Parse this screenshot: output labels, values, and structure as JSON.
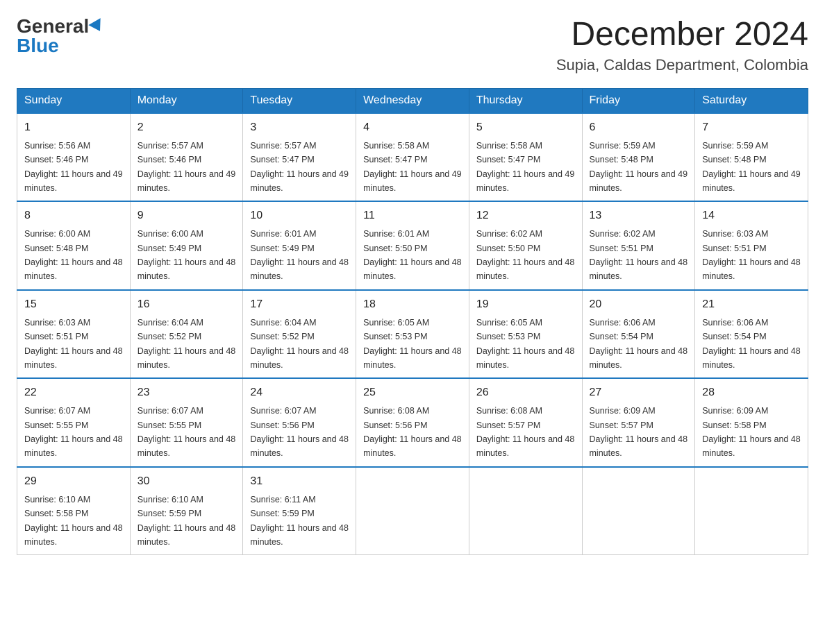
{
  "header": {
    "logo_general": "General",
    "logo_blue": "Blue",
    "month_title": "December 2024",
    "location": "Supia, Caldas Department, Colombia"
  },
  "weekdays": [
    "Sunday",
    "Monday",
    "Tuesday",
    "Wednesday",
    "Thursday",
    "Friday",
    "Saturday"
  ],
  "weeks": [
    [
      {
        "day": "1",
        "sunrise": "5:56 AM",
        "sunset": "5:46 PM",
        "daylight": "11 hours and 49 minutes."
      },
      {
        "day": "2",
        "sunrise": "5:57 AM",
        "sunset": "5:46 PM",
        "daylight": "11 hours and 49 minutes."
      },
      {
        "day": "3",
        "sunrise": "5:57 AM",
        "sunset": "5:47 PM",
        "daylight": "11 hours and 49 minutes."
      },
      {
        "day": "4",
        "sunrise": "5:58 AM",
        "sunset": "5:47 PM",
        "daylight": "11 hours and 49 minutes."
      },
      {
        "day": "5",
        "sunrise": "5:58 AM",
        "sunset": "5:47 PM",
        "daylight": "11 hours and 49 minutes."
      },
      {
        "day": "6",
        "sunrise": "5:59 AM",
        "sunset": "5:48 PM",
        "daylight": "11 hours and 49 minutes."
      },
      {
        "day": "7",
        "sunrise": "5:59 AM",
        "sunset": "5:48 PM",
        "daylight": "11 hours and 49 minutes."
      }
    ],
    [
      {
        "day": "8",
        "sunrise": "6:00 AM",
        "sunset": "5:48 PM",
        "daylight": "11 hours and 48 minutes."
      },
      {
        "day": "9",
        "sunrise": "6:00 AM",
        "sunset": "5:49 PM",
        "daylight": "11 hours and 48 minutes."
      },
      {
        "day": "10",
        "sunrise": "6:01 AM",
        "sunset": "5:49 PM",
        "daylight": "11 hours and 48 minutes."
      },
      {
        "day": "11",
        "sunrise": "6:01 AM",
        "sunset": "5:50 PM",
        "daylight": "11 hours and 48 minutes."
      },
      {
        "day": "12",
        "sunrise": "6:02 AM",
        "sunset": "5:50 PM",
        "daylight": "11 hours and 48 minutes."
      },
      {
        "day": "13",
        "sunrise": "6:02 AM",
        "sunset": "5:51 PM",
        "daylight": "11 hours and 48 minutes."
      },
      {
        "day": "14",
        "sunrise": "6:03 AM",
        "sunset": "5:51 PM",
        "daylight": "11 hours and 48 minutes."
      }
    ],
    [
      {
        "day": "15",
        "sunrise": "6:03 AM",
        "sunset": "5:51 PM",
        "daylight": "11 hours and 48 minutes."
      },
      {
        "day": "16",
        "sunrise": "6:04 AM",
        "sunset": "5:52 PM",
        "daylight": "11 hours and 48 minutes."
      },
      {
        "day": "17",
        "sunrise": "6:04 AM",
        "sunset": "5:52 PM",
        "daylight": "11 hours and 48 minutes."
      },
      {
        "day": "18",
        "sunrise": "6:05 AM",
        "sunset": "5:53 PM",
        "daylight": "11 hours and 48 minutes."
      },
      {
        "day": "19",
        "sunrise": "6:05 AM",
        "sunset": "5:53 PM",
        "daylight": "11 hours and 48 minutes."
      },
      {
        "day": "20",
        "sunrise": "6:06 AM",
        "sunset": "5:54 PM",
        "daylight": "11 hours and 48 minutes."
      },
      {
        "day": "21",
        "sunrise": "6:06 AM",
        "sunset": "5:54 PM",
        "daylight": "11 hours and 48 minutes."
      }
    ],
    [
      {
        "day": "22",
        "sunrise": "6:07 AM",
        "sunset": "5:55 PM",
        "daylight": "11 hours and 48 minutes."
      },
      {
        "day": "23",
        "sunrise": "6:07 AM",
        "sunset": "5:55 PM",
        "daylight": "11 hours and 48 minutes."
      },
      {
        "day": "24",
        "sunrise": "6:07 AM",
        "sunset": "5:56 PM",
        "daylight": "11 hours and 48 minutes."
      },
      {
        "day": "25",
        "sunrise": "6:08 AM",
        "sunset": "5:56 PM",
        "daylight": "11 hours and 48 minutes."
      },
      {
        "day": "26",
        "sunrise": "6:08 AM",
        "sunset": "5:57 PM",
        "daylight": "11 hours and 48 minutes."
      },
      {
        "day": "27",
        "sunrise": "6:09 AM",
        "sunset": "5:57 PM",
        "daylight": "11 hours and 48 minutes."
      },
      {
        "day": "28",
        "sunrise": "6:09 AM",
        "sunset": "5:58 PM",
        "daylight": "11 hours and 48 minutes."
      }
    ],
    [
      {
        "day": "29",
        "sunrise": "6:10 AM",
        "sunset": "5:58 PM",
        "daylight": "11 hours and 48 minutes."
      },
      {
        "day": "30",
        "sunrise": "6:10 AM",
        "sunset": "5:59 PM",
        "daylight": "11 hours and 48 minutes."
      },
      {
        "day": "31",
        "sunrise": "6:11 AM",
        "sunset": "5:59 PM",
        "daylight": "11 hours and 48 minutes."
      },
      null,
      null,
      null,
      null
    ]
  ]
}
